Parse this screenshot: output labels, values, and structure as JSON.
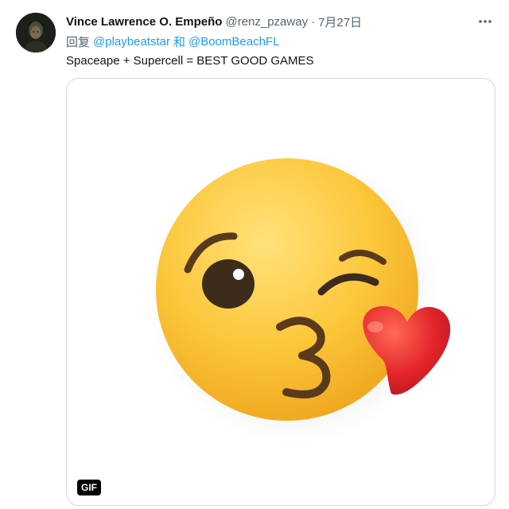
{
  "tweet": {
    "display_name": "Vince Lawrence O. Empeño",
    "handle": "@renz_pzaway",
    "separator": "·",
    "date": "7月27日",
    "more_icon": "more-horizontal-icon",
    "reply_prefix": "回复",
    "reply_mention_1": "@playbeatstar",
    "reply_conjunction": "和",
    "reply_mention_2": "@BoomBeachFL",
    "text": "Spaceape + Supercell = BEST GOOD GAMES",
    "media": {
      "type": "gif",
      "badge": "GIF",
      "subject": "face-blowing-a-kiss-emoji"
    }
  },
  "colors": {
    "link": "#1d9bf0",
    "secondary_text": "#536471",
    "primary_text": "#0f1419",
    "border": "#cfd9de"
  }
}
